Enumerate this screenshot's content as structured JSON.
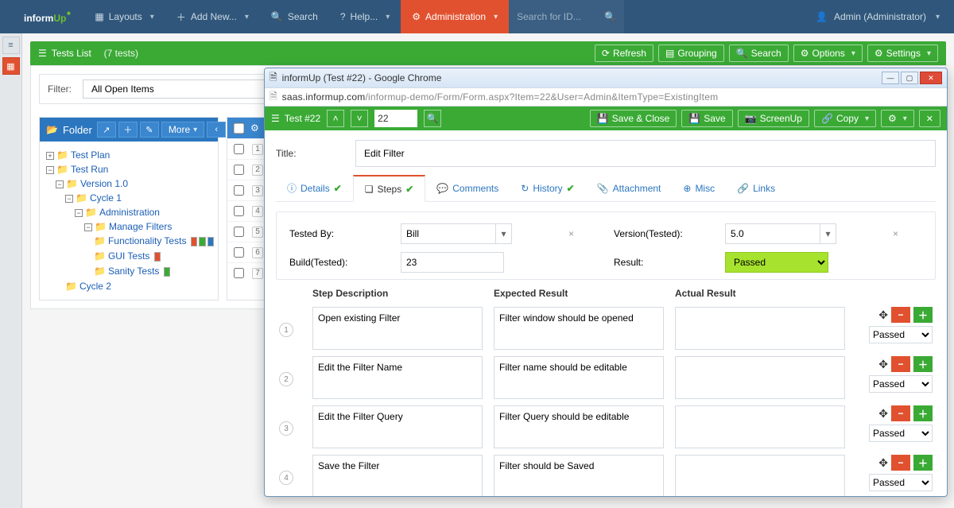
{
  "brand": {
    "part1": "inform",
    "part2": "Up"
  },
  "nav": {
    "layouts": "Layouts",
    "addnew": "Add New...",
    "search": "Search",
    "help": "Help...",
    "admin": "Administration",
    "search_placeholder": "Search for ID..."
  },
  "user": {
    "label": "Admin (Administrator)"
  },
  "tests_panel": {
    "title": "Tests List",
    "count": "(7 tests)",
    "btn_refresh": "Refresh",
    "btn_grouping": "Grouping",
    "btn_search": "Search",
    "btn_options": "Options",
    "btn_settings": "Settings",
    "filter_label": "Filter:",
    "filter_value": "All Open Items"
  },
  "folder": {
    "title": "Folder",
    "more": "More",
    "nodes": {
      "test_plan": "Test Plan",
      "test_run": "Test Run",
      "version": "Version 1.0",
      "cycle1": "Cycle 1",
      "admin": "Administration",
      "manage": "Manage Filters",
      "func": "Functionality Tests",
      "gui": "GUI Tests",
      "sanity": "Sanity Tests",
      "cycle2": "Cycle 2"
    }
  },
  "list": {
    "rows": [
      "1",
      "2",
      "3",
      "4",
      "5",
      "6",
      "7"
    ]
  },
  "modal": {
    "win_title": "informUp (Test #22) - Google Chrome",
    "url_host": "saas.informup.com",
    "url_rest": "/informup-demo/Form/Form.aspx?Item=22&User=Admin&ItemType=ExistingItem",
    "item_title": "Test #22",
    "item_num": "22",
    "btn_saveclose": "Save & Close",
    "btn_save": "Save",
    "btn_screenup": "ScreenUp",
    "btn_copy": "Copy",
    "title_label": "Title:",
    "title_value": "Edit Filter",
    "tabs": {
      "details": "Details",
      "steps": "Steps",
      "comments": "Comments",
      "history": "History",
      "attachment": "Attachment",
      "misc": "Misc",
      "links": "Links"
    },
    "fields": {
      "tested_by_label": "Tested By:",
      "tested_by": "Bill",
      "version_label": "Version(Tested):",
      "version": "5.0",
      "build_label": "Build(Tested):",
      "build": "23",
      "result_label": "Result:",
      "result": "Passed"
    },
    "steps_header": {
      "desc": "Step Description",
      "expected": "Expected Result",
      "actual": "Actual Result"
    },
    "steps": [
      {
        "n": "1",
        "desc": "Open existing Filter",
        "expected": "Filter window should be opened",
        "actual": "",
        "result": "Passed"
      },
      {
        "n": "2",
        "desc": "Edit the Filter Name",
        "expected": "Filter name should be editable",
        "actual": "",
        "result": "Passed"
      },
      {
        "n": "3",
        "desc": "Edit the Filter Query",
        "expected": "Filter Query should be editable",
        "actual": "",
        "result": "Passed"
      },
      {
        "n": "4",
        "desc": "Save the Filter",
        "expected": "Filter should be Saved",
        "actual": "",
        "result": "Passed"
      }
    ]
  }
}
